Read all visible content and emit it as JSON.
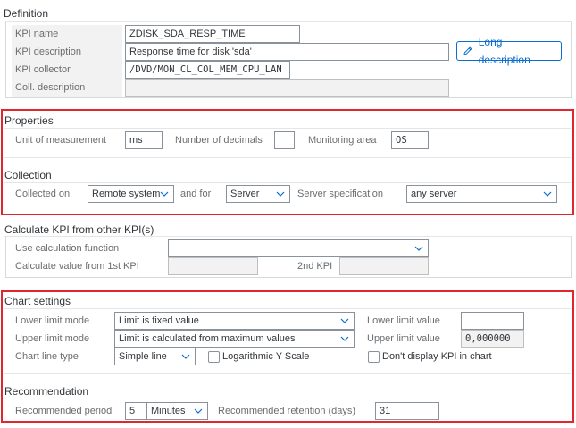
{
  "definition": {
    "title": "Definition",
    "kpi_name_label": "KPI name",
    "kpi_name_value": "ZDISK_SDA_RESP_TIME",
    "kpi_description_label": "KPI description",
    "kpi_description_value": "Response time for disk 'sda'",
    "long_description_button": "Long description",
    "kpi_collector_label": "KPI collector",
    "kpi_collector_value": "/DVD/MON_CL_COL_MEM_CPU_LAN",
    "coll_description_label": "Coll. description",
    "coll_description_value": ""
  },
  "properties": {
    "title": "Properties",
    "unit_label": "Unit of measurement",
    "unit_value": "ms",
    "decimals_label": "Number of decimals",
    "decimals_value": "",
    "monitoring_area_label": "Monitoring area",
    "monitoring_area_value": "OS"
  },
  "collection": {
    "title": "Collection",
    "collected_on_label": "Collected on",
    "collected_on_value": "Remote system",
    "and_for_label": "and for",
    "and_for_value": "Server",
    "server_spec_label": "Server specification",
    "server_spec_value": "any server"
  },
  "calculate": {
    "title": "Calculate KPI from other KPI(s)",
    "use_calc_label": "Use calculation function",
    "use_calc_value": "",
    "first_kpi_label": "Calculate value from 1st KPI",
    "first_kpi_value": "",
    "second_kpi_label": "2nd KPI",
    "second_kpi_value": ""
  },
  "chart_settings": {
    "title": "Chart settings",
    "lower_mode_label": "Lower limit mode",
    "lower_mode_value": "Limit is fixed value",
    "lower_value_label": "Lower limit value",
    "lower_value": "",
    "upper_mode_label": "Upper limit mode",
    "upper_mode_value": "Limit is calculated from maximum values",
    "upper_value_label": "Upper limit value",
    "upper_value": "0,000000",
    "line_type_label": "Chart line type",
    "line_type_value": "Simple line",
    "log_scale_label": "Logarithmic Y Scale",
    "log_scale_checked": false,
    "dont_display_label": "Don't display KPI in chart",
    "dont_display_checked": false
  },
  "recommendation": {
    "title": "Recommendation",
    "period_label": "Recommended period",
    "period_value": "5",
    "period_unit": "Minutes",
    "retention_label": "Recommended retention (days)",
    "retention_value": "31"
  },
  "colors": {
    "highlight_frame": "#e0262f",
    "accent": "#0a6ed1"
  }
}
